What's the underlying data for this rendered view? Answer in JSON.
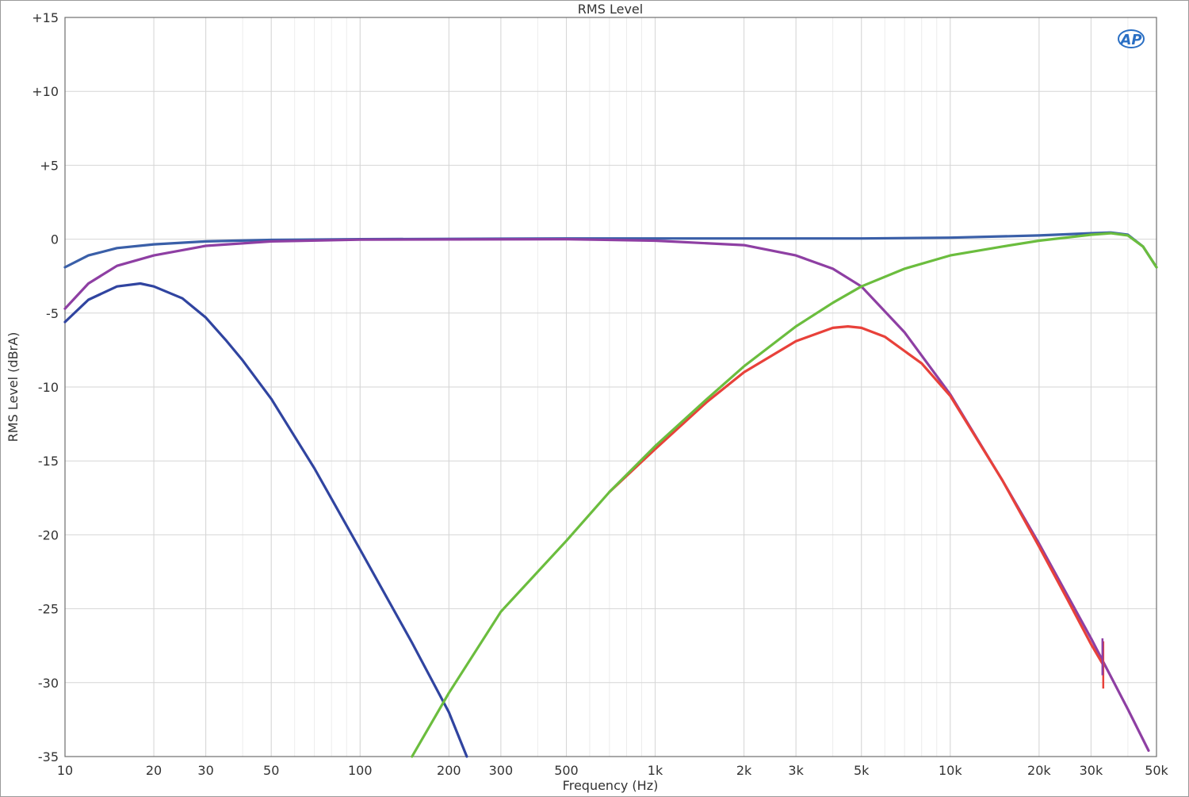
{
  "chart_data": {
    "type": "line",
    "title": "RMS Level",
    "xlabel": "Frequency (Hz)",
    "ylabel": "RMS Level (dBrA)",
    "xscale": "log",
    "xlim": [
      10,
      50000
    ],
    "ylim": [
      -35,
      15
    ],
    "grid": true,
    "logo": "AP",
    "x_ticks": [
      {
        "value": 10,
        "label": "10"
      },
      {
        "value": 20,
        "label": "20"
      },
      {
        "value": 30,
        "label": "30"
      },
      {
        "value": 50,
        "label": "50"
      },
      {
        "value": 100,
        "label": "100"
      },
      {
        "value": 200,
        "label": "200"
      },
      {
        "value": 300,
        "label": "300"
      },
      {
        "value": 500,
        "label": "500"
      },
      {
        "value": 1000,
        "label": "1k"
      },
      {
        "value": 2000,
        "label": "2k"
      },
      {
        "value": 3000,
        "label": "3k"
      },
      {
        "value": 5000,
        "label": "5k"
      },
      {
        "value": 10000,
        "label": "10k"
      },
      {
        "value": 20000,
        "label": "20k"
      },
      {
        "value": 30000,
        "label": "30k"
      },
      {
        "value": 50000,
        "label": "50k"
      }
    ],
    "y_ticks": [
      {
        "value": 15,
        "label": "+15"
      },
      {
        "value": 10,
        "label": "+10"
      },
      {
        "value": 5,
        "label": "+5"
      },
      {
        "value": 0,
        "label": "0"
      },
      {
        "value": -5,
        "label": "-5"
      },
      {
        "value": -10,
        "label": "-10"
      },
      {
        "value": -15,
        "label": "-15"
      },
      {
        "value": -20,
        "label": "-20"
      },
      {
        "value": -25,
        "label": "-25"
      },
      {
        "value": -30,
        "label": "-30"
      },
      {
        "value": -35,
        "label": "-35"
      }
    ],
    "series": [
      {
        "color": "#3a5fa8",
        "points": [
          [
            10,
            -1.9
          ],
          [
            12,
            -1.1
          ],
          [
            15,
            -0.6
          ],
          [
            20,
            -0.35
          ],
          [
            30,
            -0.15
          ],
          [
            50,
            -0.05
          ],
          [
            100,
            0
          ],
          [
            500,
            0.05
          ],
          [
            1000,
            0.05
          ],
          [
            5000,
            0.05
          ],
          [
            10000,
            0.1
          ],
          [
            20000,
            0.25
          ],
          [
            30000,
            0.4
          ],
          [
            35000,
            0.45
          ],
          [
            40000,
            0.3
          ],
          [
            45000,
            -0.5
          ],
          [
            50000,
            -1.9
          ]
        ]
      },
      {
        "color": "#8e3fa3",
        "points": [
          [
            10,
            -4.7
          ],
          [
            12,
            -3.0
          ],
          [
            15,
            -1.8
          ],
          [
            20,
            -1.1
          ],
          [
            30,
            -0.45
          ],
          [
            50,
            -0.15
          ],
          [
            100,
            -0.03
          ],
          [
            500,
            0
          ],
          [
            1000,
            -0.1
          ],
          [
            2000,
            -0.4
          ],
          [
            3000,
            -1.1
          ],
          [
            4000,
            -2.0
          ],
          [
            5000,
            -3.2
          ],
          [
            7000,
            -6.3
          ],
          [
            10000,
            -10.5
          ],
          [
            15000,
            -16.3
          ],
          [
            20000,
            -20.6
          ],
          [
            30000,
            -27.0
          ],
          [
            40000,
            -31.8
          ],
          [
            47000,
            -34.6
          ]
        ]
      },
      {
        "color": "#3044a0",
        "points": [
          [
            10,
            -5.6
          ],
          [
            12,
            -4.1
          ],
          [
            15,
            -3.2
          ],
          [
            18,
            -3.0
          ],
          [
            20,
            -3.2
          ],
          [
            25,
            -4.0
          ],
          [
            30,
            -5.3
          ],
          [
            35,
            -6.8
          ],
          [
            40,
            -8.2
          ],
          [
            50,
            -10.8
          ],
          [
            70,
            -15.5
          ],
          [
            100,
            -21.0
          ],
          [
            150,
            -27.3
          ],
          [
            200,
            -32.0
          ],
          [
            230,
            -35.0
          ]
        ]
      },
      {
        "color": "#e8413a",
        "points": [
          [
            700,
            -17.1
          ],
          [
            1000,
            -14.2
          ],
          [
            1500,
            -11.0
          ],
          [
            2000,
            -9.0
          ],
          [
            3000,
            -6.9
          ],
          [
            4000,
            -6.0
          ],
          [
            4500,
            -5.9
          ],
          [
            5000,
            -6.0
          ],
          [
            6000,
            -6.6
          ],
          [
            8000,
            -8.4
          ],
          [
            10000,
            -10.6
          ],
          [
            15000,
            -16.3
          ],
          [
            20000,
            -20.8
          ],
          [
            25000,
            -24.4
          ],
          [
            30000,
            -27.4
          ],
          [
            33000,
            -28.8
          ]
        ]
      },
      {
        "color": "#6bbd3e",
        "points": [
          [
            150,
            -35.0
          ],
          [
            200,
            -30.7
          ],
          [
            300,
            -25.2
          ],
          [
            500,
            -20.4
          ],
          [
            700,
            -17.1
          ],
          [
            1000,
            -14.0
          ],
          [
            1500,
            -10.8
          ],
          [
            2000,
            -8.6
          ],
          [
            3000,
            -5.9
          ],
          [
            4000,
            -4.3
          ],
          [
            5000,
            -3.2
          ],
          [
            7000,
            -2.0
          ],
          [
            10000,
            -1.1
          ],
          [
            15000,
            -0.5
          ],
          [
            20000,
            -0.1
          ],
          [
            30000,
            0.3
          ],
          [
            35000,
            0.4
          ],
          [
            40000,
            0.25
          ],
          [
            45000,
            -0.5
          ],
          [
            50000,
            -1.9
          ]
        ]
      }
    ]
  }
}
